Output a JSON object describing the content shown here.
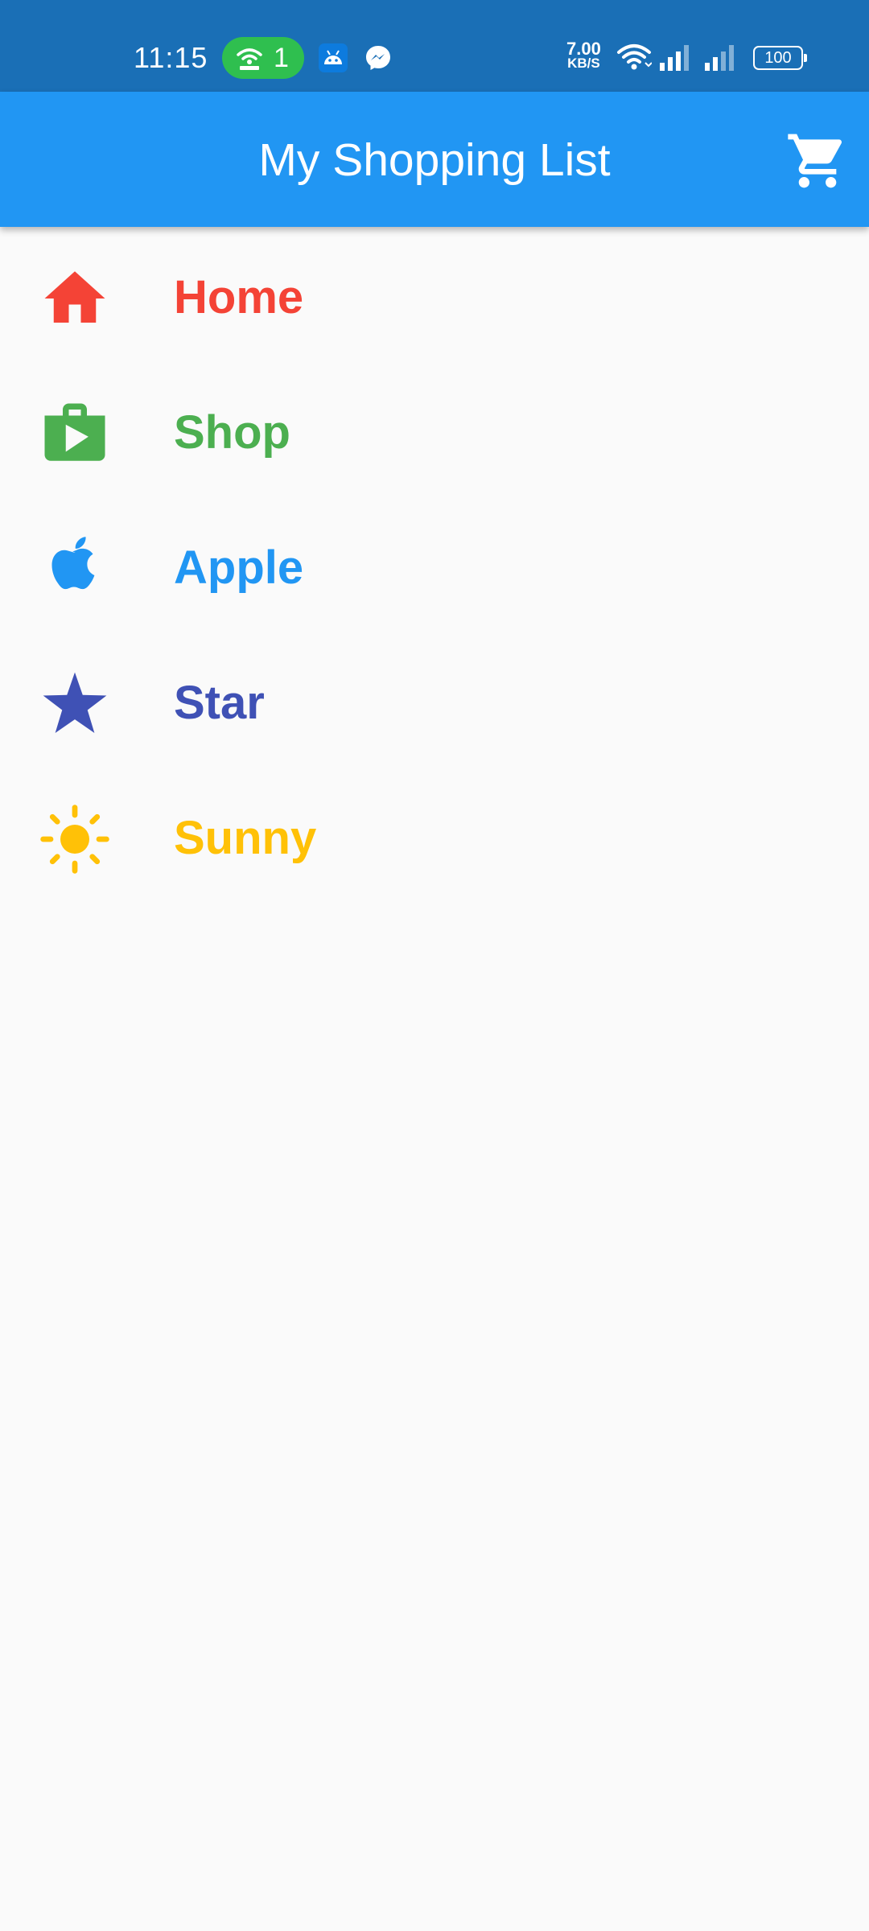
{
  "status_bar": {
    "time": "11:15",
    "hotspot_count": "1",
    "speed_value": "7.00",
    "speed_unit": "KB/S",
    "battery": "100",
    "icons": [
      "hotspot-icon",
      "android-icon",
      "messenger-icon",
      "wifi-icon",
      "signal-icon",
      "signal-icon"
    ]
  },
  "app_bar": {
    "title": "My Shopping List",
    "action_icon": "shopping-cart-icon",
    "background": "#2196f3"
  },
  "items": [
    {
      "label": "Home",
      "icon": "home-icon",
      "color": "#f44336"
    },
    {
      "label": "Shop",
      "icon": "shop-icon",
      "color": "#4caf50"
    },
    {
      "label": "Apple",
      "icon": "apple-icon",
      "color": "#2196f3"
    },
    {
      "label": "Star",
      "icon": "star-icon",
      "color": "#3f51b5"
    },
    {
      "label": "Sunny",
      "icon": "sunny-icon",
      "color": "#ffc107"
    }
  ]
}
